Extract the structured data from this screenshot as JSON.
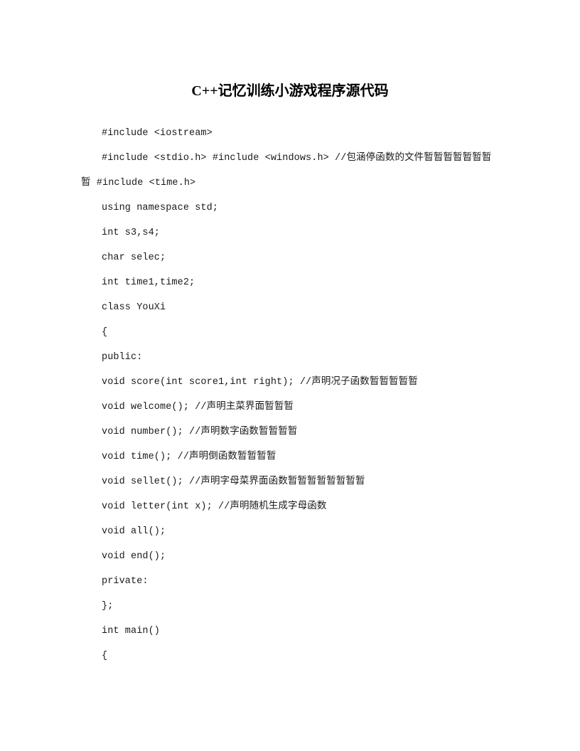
{
  "document": {
    "title": "C++记忆训练小游戏程序源代码",
    "background_color": "#ffffff",
    "text_color": "#1a1a1a"
  },
  "code": {
    "lines": [
      "#include <iostream>",
      "#include <stdio.h> #include <windows.h> //包涵停函数的文件暂暂暂暂暂暂暂暂 #include <time.h>",
      "using namespace std;",
      "int s3,s4;",
      "char selec;",
      "int time1,time2;",
      "class YouXi",
      "{",
      "public:",
      "void score(int score1,int right); //声明况子函数暂暂暂暂暂",
      "void welcome(); //声明主菜界面暂暂暂",
      "void number(); //声明数字函数暂暂暂暂",
      "void time(); //声明倒函数暂暂暂暂",
      "void sellet(); //声明字母菜界面函数暂暂暂暂暂暂暂暂",
      "void letter(int x); //声明随机生成字母函数",
      "void all();",
      "void end();",
      "private:",
      "};",
      "int main()",
      "{"
    ]
  }
}
